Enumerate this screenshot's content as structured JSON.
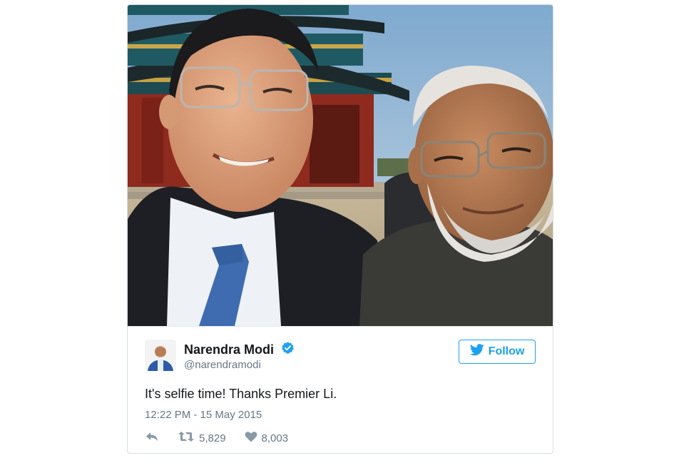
{
  "tweet": {
    "author_name": "Narendra Modi",
    "author_handle": "@narendramodi",
    "follow_label": "Follow",
    "text": "It's selfie time! Thanks Premier Li.",
    "timestamp": "12:22 PM - 15 May 2015",
    "retweet_count": "5,829",
    "like_count": "8,003",
    "verified": true
  },
  "colors": {
    "twitter_blue": "#1da1f2",
    "text_primary": "#14171a",
    "text_secondary": "#657786",
    "action_gray": "#8899a6"
  },
  "icons": {
    "verified": "verified-badge-icon",
    "bird": "twitter-bird-icon",
    "reply": "reply-icon",
    "retweet": "retweet-icon",
    "like": "heart-icon"
  }
}
